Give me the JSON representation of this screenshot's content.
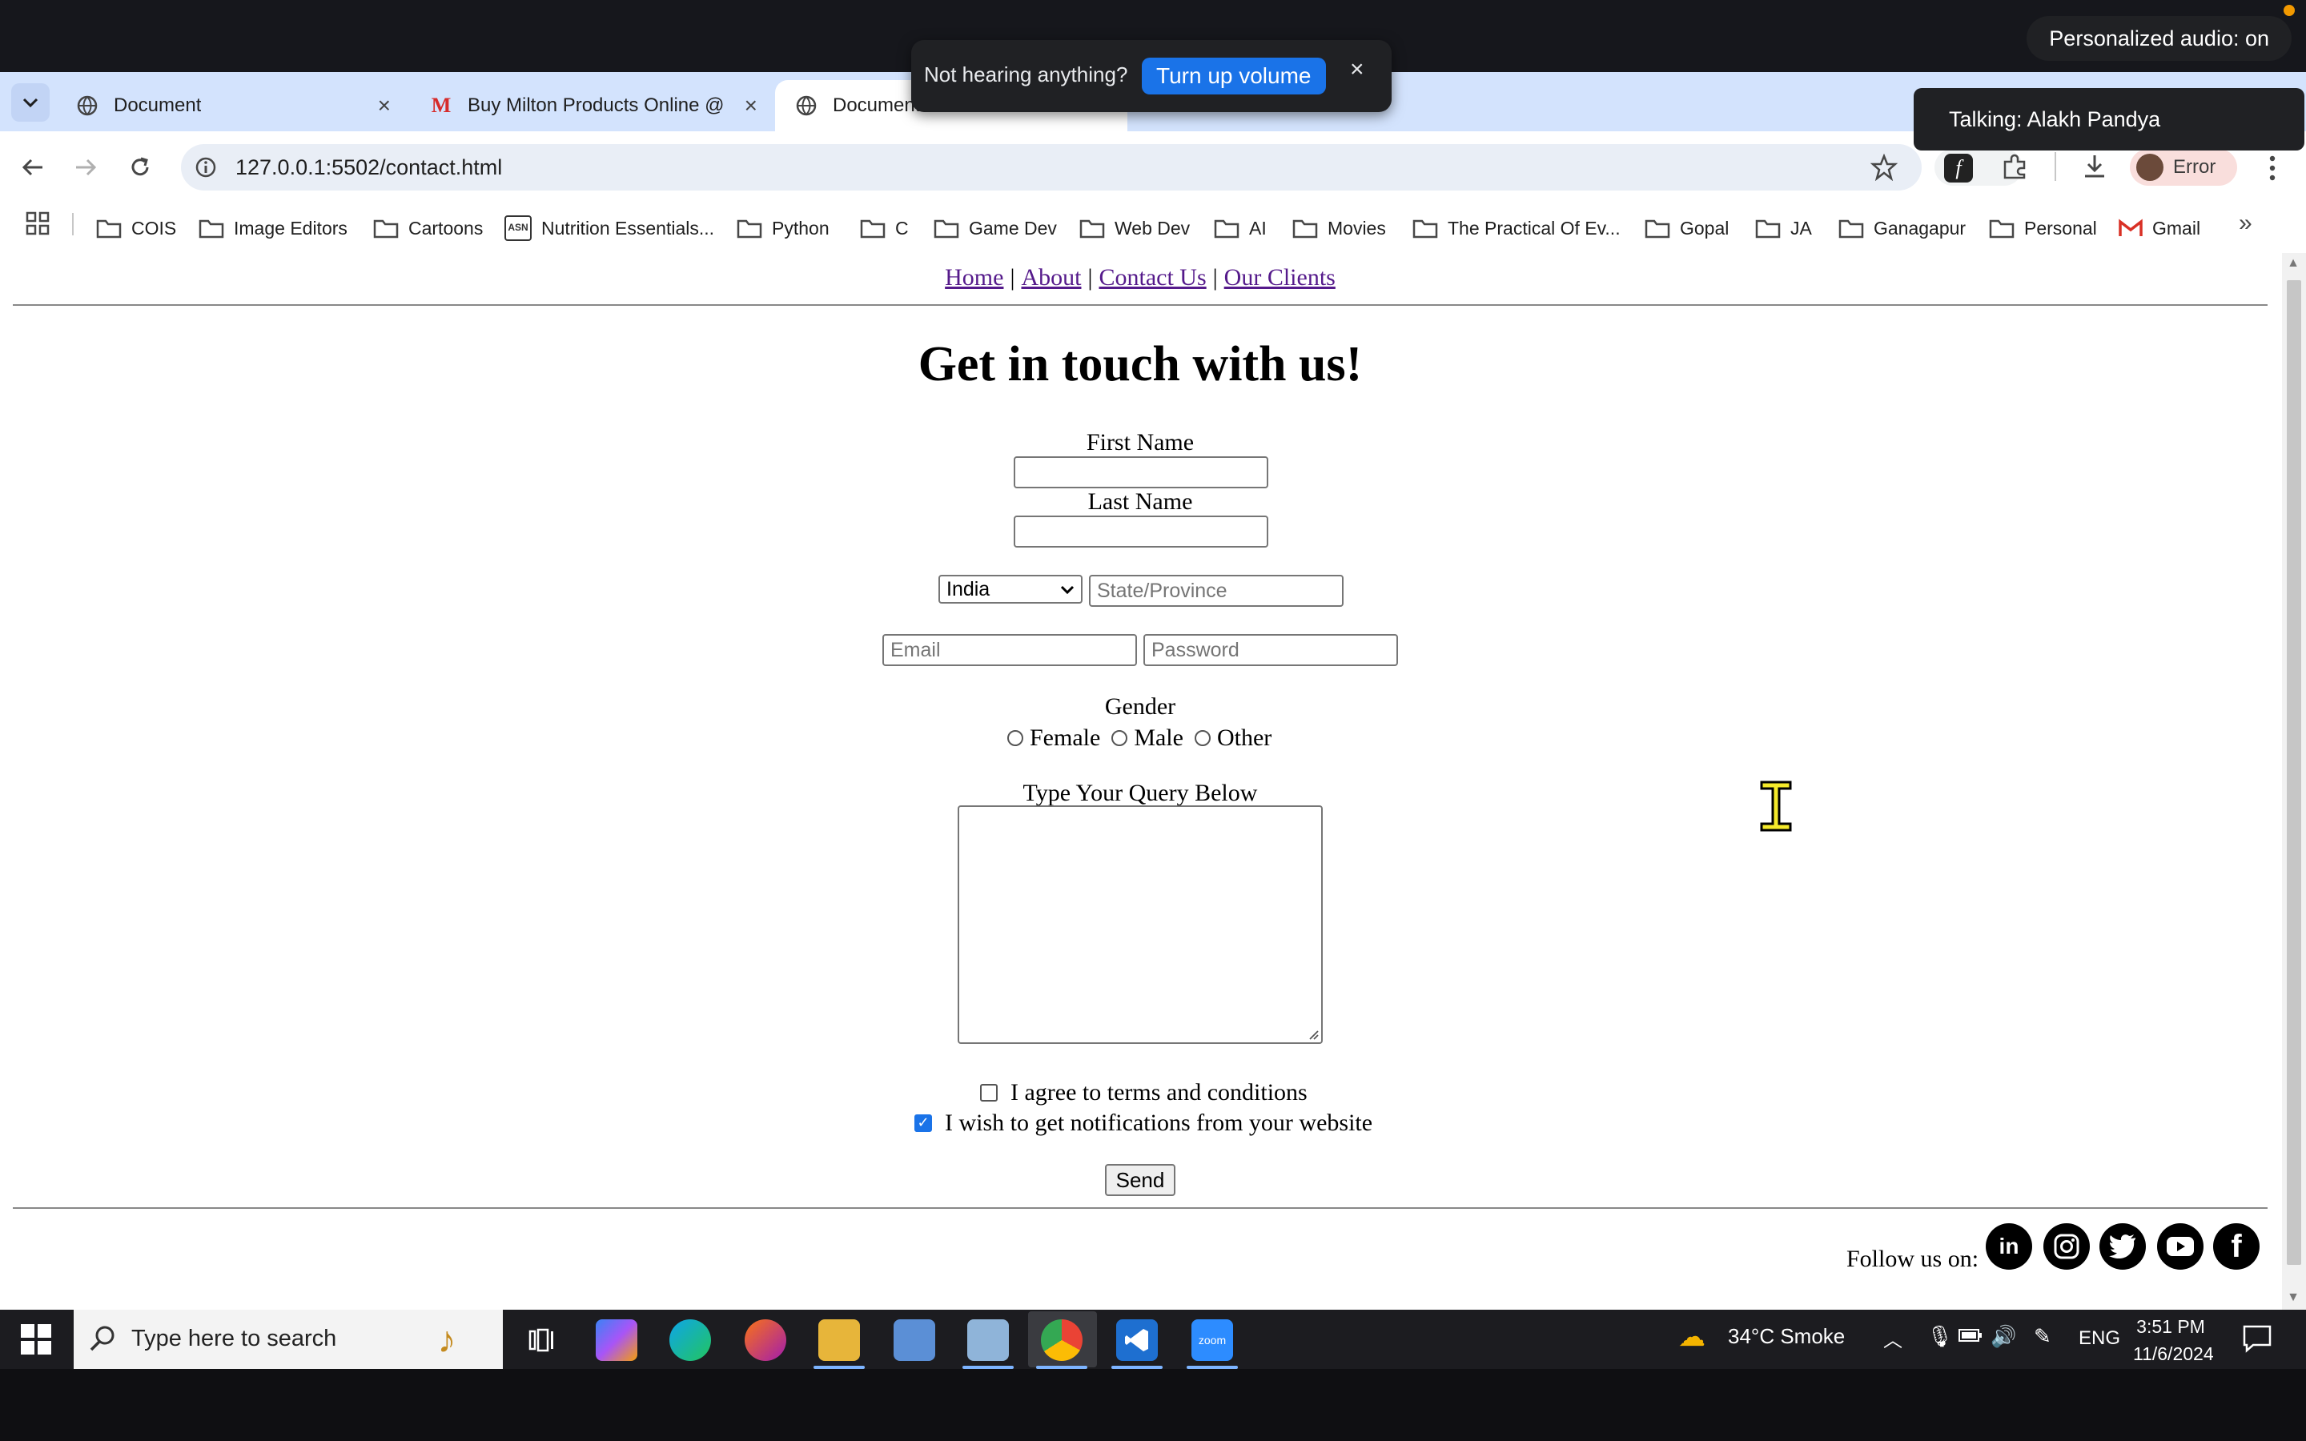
{
  "system": {
    "audio_status": "Personalized audio: on",
    "talking": "Talking: Alakh Pandya"
  },
  "volume_popup": {
    "text": "Not hearing anything?",
    "button": "Turn up volume",
    "close": "×"
  },
  "tabs": [
    {
      "title": "Document",
      "icon": "globe-icon",
      "close": "×"
    },
    {
      "title": "Buy Milton Products Online @",
      "icon": "milton-logo-icon",
      "close": "×"
    },
    {
      "title": "Document",
      "icon": "globe-icon"
    }
  ],
  "toolbar": {
    "url": "127.0.0.1:5502/contact.html",
    "profile_label": "Error"
  },
  "bookmarks": [
    {
      "label": "COIS",
      "icon": "folder-icon"
    },
    {
      "label": "Image Editors",
      "icon": "folder-icon"
    },
    {
      "label": "Cartoons",
      "icon": "folder-icon"
    },
    {
      "label": "Nutrition Essentials...",
      "icon": "site-icon"
    },
    {
      "label": "Python",
      "icon": "folder-icon"
    },
    {
      "label": "C",
      "icon": "folder-icon"
    },
    {
      "label": "Game Dev",
      "icon": "folder-icon"
    },
    {
      "label": "Web Dev",
      "icon": "folder-icon"
    },
    {
      "label": "AI",
      "icon": "folder-icon"
    },
    {
      "label": "Movies",
      "icon": "folder-icon"
    },
    {
      "label": "The Practical Of Ev...",
      "icon": "folder-icon"
    },
    {
      "label": "Gopal",
      "icon": "folder-icon"
    },
    {
      "label": "JA",
      "icon": "folder-icon"
    },
    {
      "label": "Ganagapur",
      "icon": "folder-icon"
    },
    {
      "label": "Personal",
      "icon": "folder-icon"
    },
    {
      "label": "Gmail",
      "icon": "gmail-icon"
    }
  ],
  "page": {
    "nav": {
      "home": "Home",
      "about": "About",
      "contact": "Contact Us",
      "clients": "Our Clients",
      "separator": "|"
    },
    "heading": "Get in touch with us!",
    "first_name_label": "First Name",
    "last_name_label": "Last Name",
    "country_selected": "India",
    "state_placeholder": "State/Province",
    "email_placeholder": "Email",
    "password_placeholder": "Password",
    "gender_label": "Gender",
    "gender_options": [
      "Female",
      "Male",
      "Other"
    ],
    "query_label": "Type Your Query Below",
    "terms_label": "I agree to terms and conditions",
    "terms_checked": false,
    "notify_label": "I wish to get notifications from your website",
    "notify_checked": true,
    "send_label": "Send",
    "follow_label": "Follow us on:",
    "social": [
      "linkedin-icon",
      "instagram-icon",
      "twitter-icon",
      "youtube-icon",
      "facebook-icon"
    ]
  },
  "taskbar": {
    "search_placeholder": "Type here to search",
    "weather": "34°C  Smoke",
    "language": "ENG",
    "time": "3:51 PM",
    "date": "11/6/2024"
  }
}
